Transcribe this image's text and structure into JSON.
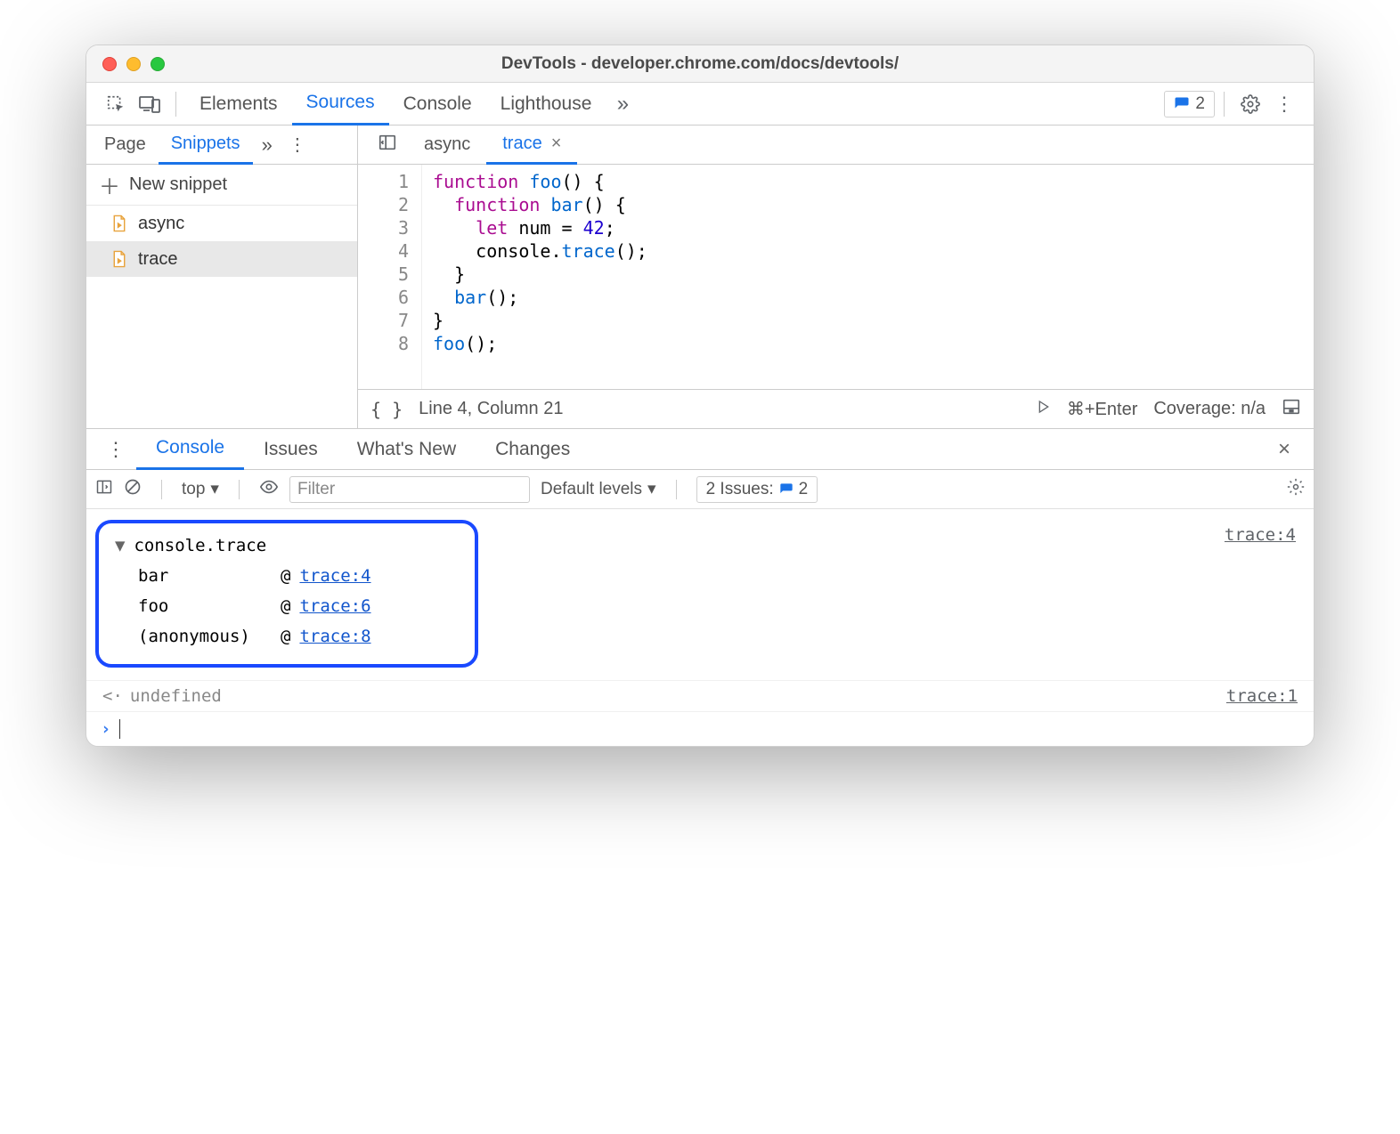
{
  "window": {
    "title": "DevTools - developer.chrome.com/docs/devtools/"
  },
  "toolbar": {
    "tabs": [
      "Elements",
      "Sources",
      "Console",
      "Lighthouse"
    ],
    "active": "Sources",
    "issues_count": "2"
  },
  "sidebar": {
    "tabs": [
      "Page",
      "Snippets"
    ],
    "active": "Snippets",
    "new_label": "New snippet",
    "files": [
      {
        "name": "async",
        "selected": false
      },
      {
        "name": "trace",
        "selected": true
      }
    ]
  },
  "editor": {
    "open_tabs": [
      {
        "name": "async",
        "active": false,
        "closable": false
      },
      {
        "name": "trace",
        "active": true,
        "closable": true
      }
    ],
    "code": [
      [
        {
          "t": "function ",
          "c": "kw"
        },
        {
          "t": "foo",
          "c": "fn"
        },
        {
          "t": "() {",
          "c": ""
        }
      ],
      [
        {
          "t": "  ",
          "c": ""
        },
        {
          "t": "function ",
          "c": "kw"
        },
        {
          "t": "bar",
          "c": "fn"
        },
        {
          "t": "() {",
          "c": ""
        }
      ],
      [
        {
          "t": "    ",
          "c": ""
        },
        {
          "t": "let ",
          "c": "kw"
        },
        {
          "t": "num = ",
          "c": ""
        },
        {
          "t": "42",
          "c": "num"
        },
        {
          "t": ";",
          "c": ""
        }
      ],
      [
        {
          "t": "    console.",
          "c": ""
        },
        {
          "t": "trace",
          "c": "fn"
        },
        {
          "t": "();",
          "c": ""
        }
      ],
      [
        {
          "t": "  }",
          "c": ""
        }
      ],
      [
        {
          "t": "  ",
          "c": ""
        },
        {
          "t": "bar",
          "c": "fn"
        },
        {
          "t": "();",
          "c": ""
        }
      ],
      [
        {
          "t": "}",
          "c": ""
        }
      ],
      [
        {
          "t": "foo",
          "c": "fn"
        },
        {
          "t": "();",
          "c": ""
        }
      ]
    ],
    "status": {
      "pos": "Line 4, Column 21",
      "run": "⌘+Enter",
      "coverage": "Coverage: n/a"
    }
  },
  "drawer": {
    "tabs": [
      "Console",
      "Issues",
      "What's New",
      "Changes"
    ],
    "active": "Console",
    "toolbar": {
      "context": "top",
      "filter_placeholder": "Filter",
      "levels": "Default levels",
      "issues_label": "2 Issues:",
      "issues_count": "2"
    },
    "trace": {
      "header": "console.trace",
      "source": "trace:4",
      "stack": [
        {
          "fn": "bar",
          "at": "trace:4"
        },
        {
          "fn": "foo",
          "at": "trace:6"
        },
        {
          "fn": "(anonymous)",
          "at": "trace:8"
        }
      ]
    },
    "return_line": {
      "value": "undefined",
      "source": "trace:1"
    }
  }
}
